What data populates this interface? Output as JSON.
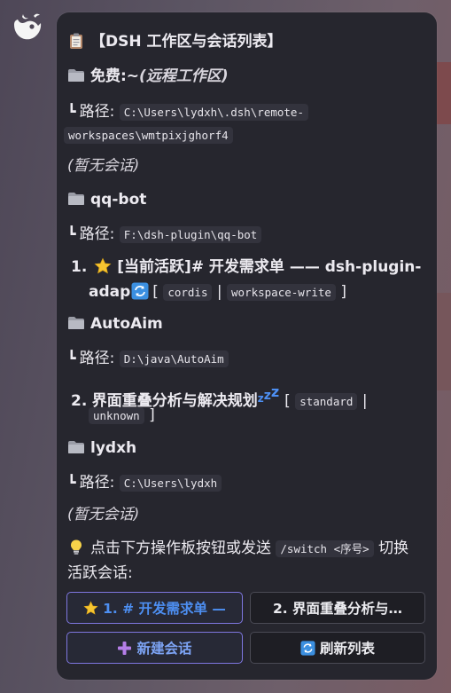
{
  "bot": {
    "avatar_icon": "whale-bot-icon"
  },
  "card": {
    "title": "【DSH 工作区与会话列表】",
    "title_icon": "clipboard-icon",
    "workspaces": [
      {
        "name": "免费:~",
        "suffix": "(远程工作区)",
        "path_label": "路径:",
        "path_line1": "C:\\Users\\lydxh\\.dsh\\remote-",
        "path_line2": "workspaces\\wmtpixjghorf4",
        "empty": "(暂无会话)"
      },
      {
        "name": "qq-bot",
        "path_label": "路径:",
        "path": "F:\\dsh-plugin\\qq-bot",
        "session": {
          "number": "1.",
          "star_icon": "star-icon",
          "title_line1": "[当前活跃]# 开发需求单 —— dsh-plugin-",
          "title_line2": "adap",
          "refresh_icon": "refresh-icon",
          "tag1": "cordis",
          "tag2": "workspace-write"
        }
      },
      {
        "name": "AutoAim",
        "path_label": "路径:",
        "path": "D:\\java\\AutoAim",
        "session": {
          "number": "2.",
          "title": "界面重叠分析与解决规划",
          "zzz_icon": "sleeping-zzz-icon",
          "tag1": "standard",
          "tag2": "unknown"
        }
      },
      {
        "name": "lydxh",
        "path_label": "路径:",
        "path": "C:\\Users\\lydxh",
        "empty": "(暂无会话)"
      }
    ],
    "hint": {
      "icon": "lightbulb-icon",
      "text_before": "点击下方操作板按钮或发送",
      "command": "/switch <序号>",
      "text_after": "切换",
      "line2": "活跃会话:"
    },
    "buttons": {
      "session1": "1. # 开发需求单 —",
      "session2": "2. 界面重叠分析与…",
      "new_session": "新建会话",
      "refresh_list": "刷新列表"
    }
  },
  "colors": {
    "card_bg": "#26262e",
    "primary_border": "#7f77e0",
    "primary_text": "#4d8ff2"
  }
}
